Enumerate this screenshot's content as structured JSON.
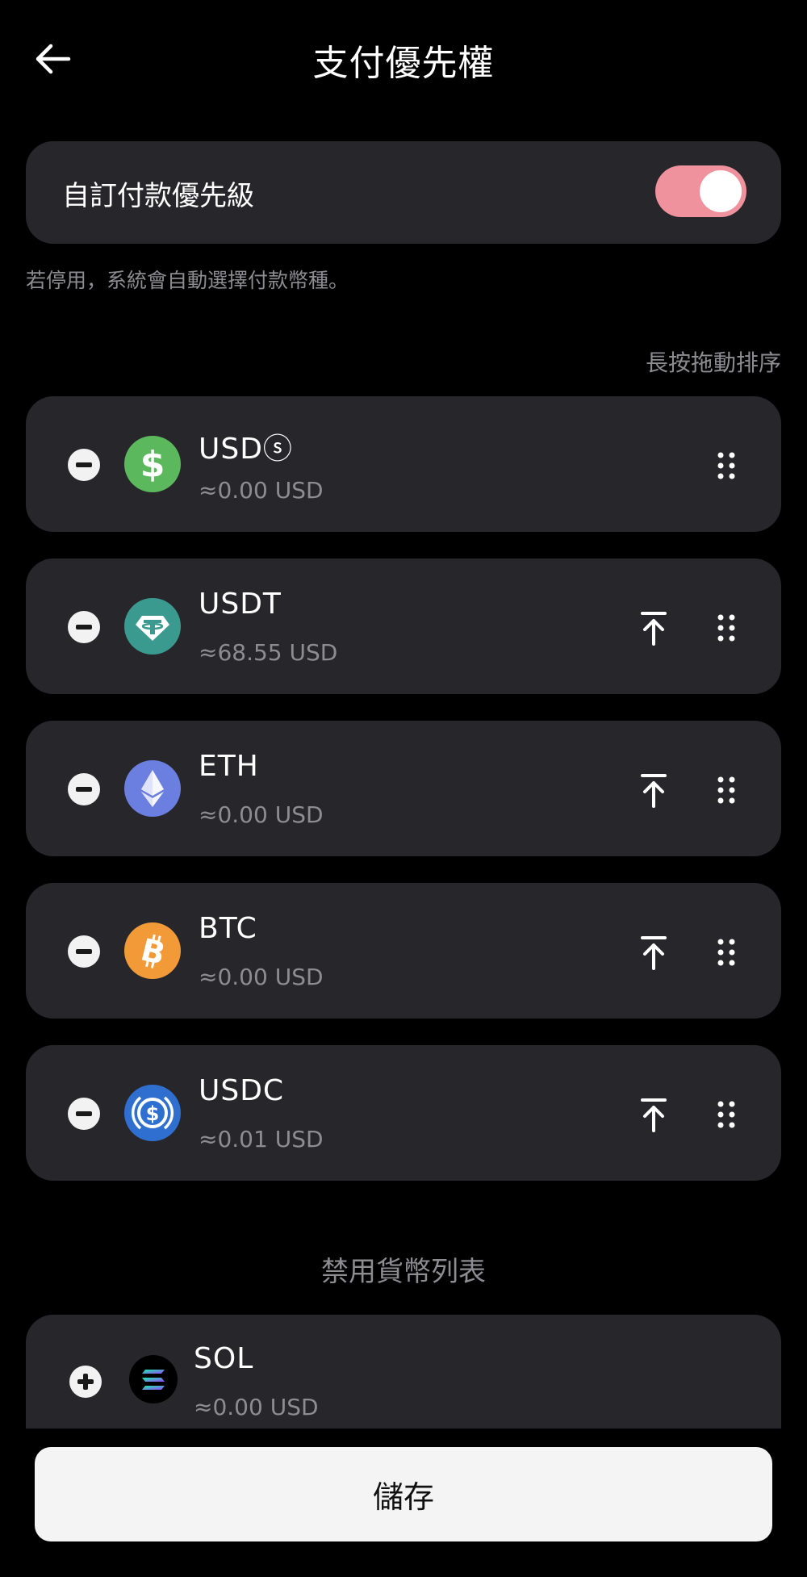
{
  "header": {
    "title": "支付優先權",
    "back_icon": "arrow-left-icon"
  },
  "custom_priority": {
    "label": "自訂付款優先級",
    "enabled": true,
    "toggle_color": "#f0929d"
  },
  "hint": "若停用，系統會自動選擇付款幣種。",
  "sort_hint": "長按拖動排序",
  "coins": [
    {
      "name": "USDⓢ",
      "value": "≈0.00 USD",
      "icon": "usds-dollar-icon",
      "color": "#5cb85c",
      "show_top": false
    },
    {
      "name": "USDT",
      "value": "≈68.55 USD",
      "icon": "tether-icon",
      "color": "#3a9a8f",
      "show_top": true
    },
    {
      "name": "ETH",
      "value": "≈0.00 USD",
      "icon": "ethereum-icon",
      "color": "#6b7fe0",
      "show_top": true
    },
    {
      "name": "BTC",
      "value": "≈0.00 USD",
      "icon": "bitcoin-icon",
      "color": "#f29a38",
      "show_top": true
    },
    {
      "name": "USDC",
      "value": "≈0.01 USD",
      "icon": "usdc-icon",
      "color": "#2f6fcf",
      "show_top": true
    }
  ],
  "disabled_section": {
    "title": "禁用貨幣列表",
    "coins": [
      {
        "name": "SOL",
        "value": "≈0.00 USD",
        "icon": "solana-icon",
        "color": "#000000"
      }
    ]
  },
  "save_button": {
    "label": "儲存"
  }
}
